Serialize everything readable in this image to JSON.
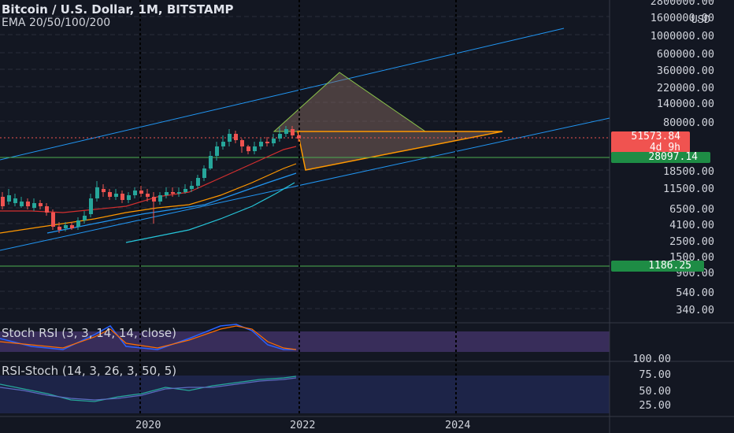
{
  "header": {
    "title": "Bitcoin / U.S. Dollar, 1M, BITSTAMP",
    "indicators": "EMA 20/50/100/200"
  },
  "price_axis": {
    "currency": "USD",
    "ticks": [
      "2800000.00",
      "1600000.00",
      "1000000.00",
      "600000.00",
      "360000.00",
      "220000.00",
      "140000.00",
      "80000.00",
      "18500.00",
      "11500.00",
      "6500.00",
      "4100.00",
      "2500.00",
      "1500.00",
      "900.00",
      "540.00",
      "340.00"
    ]
  },
  "badges": {
    "last_price": "51573.84",
    "countdown": "4d 9h",
    "level_upper": "28097.14",
    "level_lower": "1186.25"
  },
  "stoch_rsi": {
    "label": "Stoch RSI (3, 3, 14, 14, close)"
  },
  "rsi_stoch": {
    "label": "RSI-Stoch (14, 3, 26, 3, 50, 5)",
    "ticks": [
      "100.00",
      "75.00",
      "50.00",
      "25.00"
    ]
  },
  "time_axis": {
    "ticks": [
      "2020",
      "2022",
      "2024"
    ]
  },
  "colors": {
    "background": "#131722",
    "bull": "#26a69a",
    "bear": "#ef5350",
    "channel": "#2196f3",
    "triangle_green": "#8bc34a",
    "triangle_orange": "#ff9800",
    "level_green": "#4caf50"
  }
}
